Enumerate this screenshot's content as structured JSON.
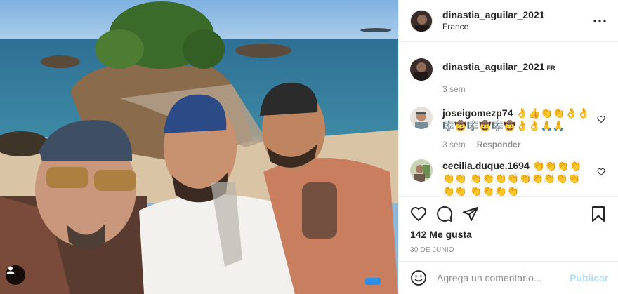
{
  "post": {
    "author": {
      "username": "dinastia_aguilar_2021",
      "location": "France"
    },
    "caption": {
      "username": "dinastia_aguilar_2021",
      "text": "",
      "badge": "FR",
      "time": "3 sem"
    },
    "comments": [
      {
        "username": "joseigomezp74",
        "text": "👌👍👏👏👌👌 🎼🤠🎼🤠🎼🤠👌👌🙏🙏",
        "time": "3 sem",
        "reply_label": "Responder"
      },
      {
        "username": "cecilia.duque.1694",
        "text": "👏👏👏👏👏👏 👏👏👏👏👏👏👏👏👏👏👏 👏👏👏👏",
        "time": "",
        "reply_label": ""
      }
    ],
    "likes_text": "142 Me gusta",
    "date_text": "30 DE JUNIO",
    "add_comment": {
      "placeholder": "Agrega un comentario...",
      "publish_label": "Publicar"
    }
  },
  "icons": {
    "more": "more-horizontal-icon",
    "like": "heart-outline-icon",
    "comment": "comment-bubble-icon",
    "share": "paper-plane-icon",
    "save": "bookmark-icon",
    "emoji": "smiley-icon",
    "tag": "user-tag-icon"
  },
  "colors": {
    "publish_disabled": "#b2dffc",
    "secondary_text": "#8e8e8e",
    "border": "#efefef"
  }
}
